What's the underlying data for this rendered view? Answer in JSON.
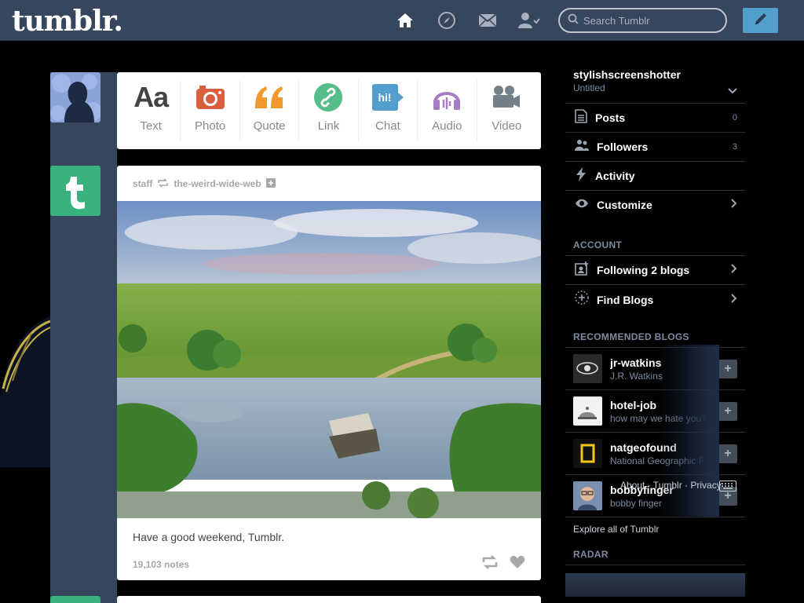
{
  "header": {
    "logo": "tumblr.",
    "search_placeholder": "Search Tumblr",
    "nav": [
      {
        "icon": "home-icon"
      },
      {
        "icon": "explore-compass-icon"
      },
      {
        "icon": "inbox-mail-icon"
      },
      {
        "icon": "account-icon"
      }
    ],
    "compose_icon": "pencil-icon"
  },
  "post_types": [
    {
      "label": "Text",
      "icon": "text-aa-icon",
      "color": "#444444"
    },
    {
      "label": "Photo",
      "icon": "camera-icon",
      "color": "#d95e40"
    },
    {
      "label": "Quote",
      "icon": "quote-icon",
      "color": "#f2992e"
    },
    {
      "label": "Link",
      "icon": "link-icon",
      "color": "#56bc8a"
    },
    {
      "label": "Chat",
      "icon": "chat-icon",
      "color": "#529ecc"
    },
    {
      "label": "Audio",
      "icon": "headphones-icon",
      "color": "#a77dc2"
    },
    {
      "label": "Video",
      "icon": "video-camera-icon",
      "color": "#748089"
    }
  ],
  "post": {
    "author": "staff",
    "reblogged_from": "the-weird-wide-web",
    "caption": "Have a good weekend, Tumblr.",
    "notes": "19,103 notes"
  },
  "sidebar": {
    "blog_name": "stylishscreenshotter",
    "blog_title": "Untitled",
    "items": [
      {
        "label": "Posts",
        "count": "0",
        "icon": "posts-icon"
      },
      {
        "label": "Followers",
        "count": "3",
        "icon": "followers-icon"
      },
      {
        "label": "Activity",
        "count": "",
        "icon": "activity-bolt-icon"
      },
      {
        "label": "Customize",
        "count": "",
        "icon": "customize-eye-icon"
      }
    ],
    "account_header": "ACCOUNT",
    "account_items": [
      {
        "label": "Following 2 blogs",
        "icon": "following-icon"
      },
      {
        "label": "Find Blogs",
        "icon": "find-blogs-icon"
      }
    ],
    "recommended_header": "RECOMMENDED BLOGS",
    "recommended": [
      {
        "name": "jr-watkins",
        "sub": "J.R. Watkins"
      },
      {
        "name": "hotel-job",
        "sub": "how may we hate you?"
      },
      {
        "name": "natgeofound",
        "sub": "National Geographic F"
      },
      {
        "name": "bobbyfinger",
        "sub": "bobby finger"
      }
    ],
    "explore": "Explore all of Tumblr",
    "radar_header": "RADAR"
  },
  "overlay": {
    "text": "About · Tumblr · Privacy",
    "icon": "keyboard-icon"
  },
  "colors": {
    "header_bg": "#36465d",
    "tumblr_green": "#3ab27d",
    "compose_blue": "#529ecc"
  }
}
